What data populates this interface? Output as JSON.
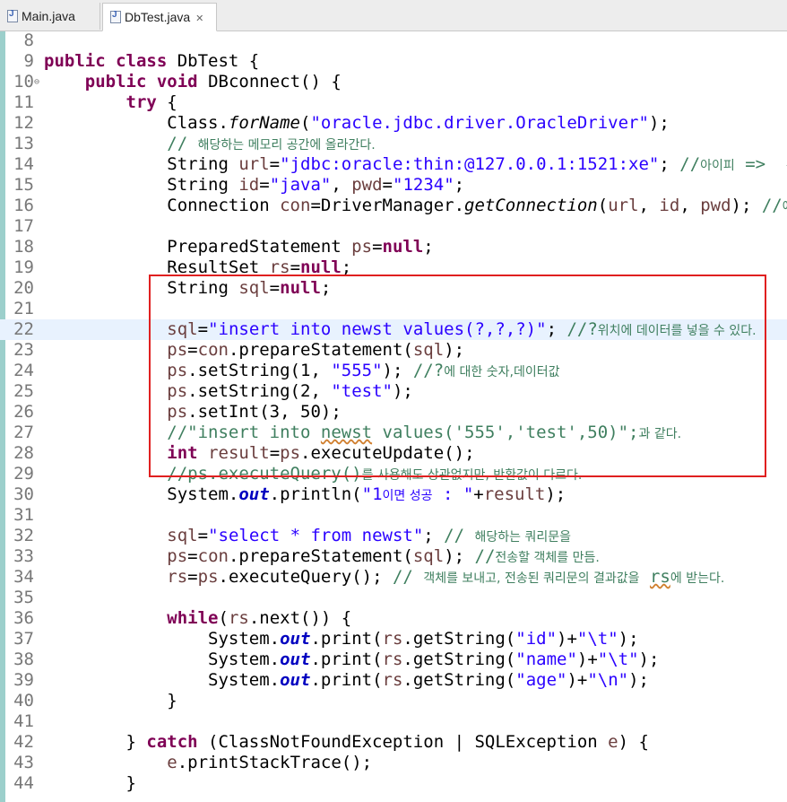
{
  "tabs": [
    {
      "label": "Main.java",
      "active": false
    },
    {
      "label": "DbTest.java",
      "active": true,
      "close": "✕"
    }
  ],
  "editor": {
    "lines": [
      {
        "n": "8",
        "html": ""
      },
      {
        "n": "9",
        "html": "<span class='kw'>public</span> <span class='kw'>class</span> DbTest {"
      },
      {
        "n": "10",
        "fold": "⊖",
        "html": "    <span class='kw'>public</span> <span class='kw'>void</span> DBconnect() {"
      },
      {
        "n": "11",
        "html": "        <span class='kw'>try</span> {"
      },
      {
        "n": "12",
        "html": "            Class.<span class='it'>forName</span>(<span class='str'>\"oracle.jdbc.driver.OracleDriver\"</span>);"
      },
      {
        "n": "13",
        "html": "            <span class='cm'>// <span class='kr'>해당하는 메모리 공간에 올라간다.</span></span>"
      },
      {
        "n": "14",
        "html": "            String <span class='lv'>url</span>=<span class='str'>\"jdbc:oracle:thin:@127.0.0.1:1521:xe\"</span>; <span class='cm'>//<span class='kr'>아이피</span> =&gt;  <span class='kr'>본인꺼</span></span>"
      },
      {
        "n": "15",
        "html": "            String <span class='lv'>id</span>=<span class='str'>\"java\"</span>, <span class='lv'>pwd</span>=<span class='str'>\"1234\"</span>;"
      },
      {
        "n": "16",
        "html": "            Connection <span class='lv'>con</span>=DriverManager.<span class='it'>getConnection</span>(<span class='lv'>url</span>, <span class='lv'>id</span>, <span class='lv'>pwd</span>); <span class='cm'>//<span class='kr'>예외처</span></span>"
      },
      {
        "n": "17",
        "html": ""
      },
      {
        "n": "18",
        "html": "            PreparedStatement <span class='lv'>ps</span>=<span class='kw'>null</span>;"
      },
      {
        "n": "19",
        "html": "            ResultSet <span class='lv'>rs</span>=<span class='kw'>null</span>;"
      },
      {
        "n": "20",
        "html": "            String <span class='lv'>sql</span>=<span class='kw'>null</span>;"
      },
      {
        "n": "21",
        "html": ""
      },
      {
        "n": "22",
        "current": true,
        "html": "            <span class='lv'>sql</span>=<span class='str'>\"insert into newst values(?,?,?)\"</span>; <span class='cm'>//?<span class='kr'>위치에 데이터를 넣을 수 있다.</span></span>"
      },
      {
        "n": "23",
        "html": "            <span class='lv'>ps</span>=<span class='lv'>con</span>.prepareStatement(<span class='lv'>sql</span>);"
      },
      {
        "n": "24",
        "html": "            <span class='lv'>ps</span>.setString(1, <span class='str'>\"555\"</span>); <span class='cm'>//?<span class='kr'>에 대한 숫자,데이터값</span></span>"
      },
      {
        "n": "25",
        "html": "            <span class='lv'>ps</span>.setString(2, <span class='str'>\"test\"</span>);"
      },
      {
        "n": "26",
        "html": "            <span class='lv'>ps</span>.setInt(3, 50);"
      },
      {
        "n": "27",
        "html": "            <span class='cm'>//\"insert into <span class='sq'>newst</span> values('555','test',50)\";<span class='kr'>과 같다.</span></span>"
      },
      {
        "n": "28",
        "html": "            <span class='kw'>int</span> <span class='lv'>result</span>=<span class='lv'>ps</span>.executeUpdate();"
      },
      {
        "n": "29",
        "html": "            <span class='cm'>//ps.executeQuery()<span class='kr'>를 사용해도 상관없지만, 반환값이 다르다.</span></span>"
      },
      {
        "n": "30",
        "html": "            System.<span class='fld'>out</span>.println(<span class='str'>\"1<span class='kr'>이면 성공</span> : \"</span>+<span class='lv'>result</span>);"
      },
      {
        "n": "31",
        "html": ""
      },
      {
        "n": "32",
        "html": "            <span class='lv'>sql</span>=<span class='str'>\"select * from newst\"</span>; <span class='cm'>// <span class='kr'>해당하는 쿼리문을</span></span>"
      },
      {
        "n": "33",
        "html": "            <span class='lv'>ps</span>=<span class='lv'>con</span>.prepareStatement(<span class='lv'>sql</span>); <span class='cm'>//<span class='kr'>전송할 객체를 만듬.</span></span>"
      },
      {
        "n": "34",
        "html": "            <span class='lv'>rs</span>=<span class='lv'>ps</span>.executeQuery(); <span class='cm'>// <span class='kr'>객체를 보내고, 전송된 쿼리문의 결과값을</span> <span class='sq'>rs</span><span class='kr'>에 받는다.</span></span>"
      },
      {
        "n": "35",
        "html": ""
      },
      {
        "n": "36",
        "html": "            <span class='kw'>while</span>(<span class='lv'>rs</span>.next()) {"
      },
      {
        "n": "37",
        "html": "                System.<span class='fld'>out</span>.print(<span class='lv'>rs</span>.getString(<span class='str'>\"id\"</span>)+<span class='str'>\"\\t\"</span>);"
      },
      {
        "n": "38",
        "html": "                System.<span class='fld'>out</span>.print(<span class='lv'>rs</span>.getString(<span class='str'>\"name\"</span>)+<span class='str'>\"\\t\"</span>);"
      },
      {
        "n": "39",
        "html": "                System.<span class='fld'>out</span>.print(<span class='lv'>rs</span>.getString(<span class='str'>\"age\"</span>)+<span class='str'>\"\\n\"</span>);"
      },
      {
        "n": "40",
        "html": "            }"
      },
      {
        "n": "41",
        "html": ""
      },
      {
        "n": "42",
        "html": "        } <span class='kw'>catch</span> (ClassNotFoundException | SQLException <span class='lv'>e</span>) {"
      },
      {
        "n": "43",
        "html": "            <span class='lv'>e</span>.printStackTrace();"
      },
      {
        "n": "44",
        "html": "        }"
      }
    ]
  }
}
